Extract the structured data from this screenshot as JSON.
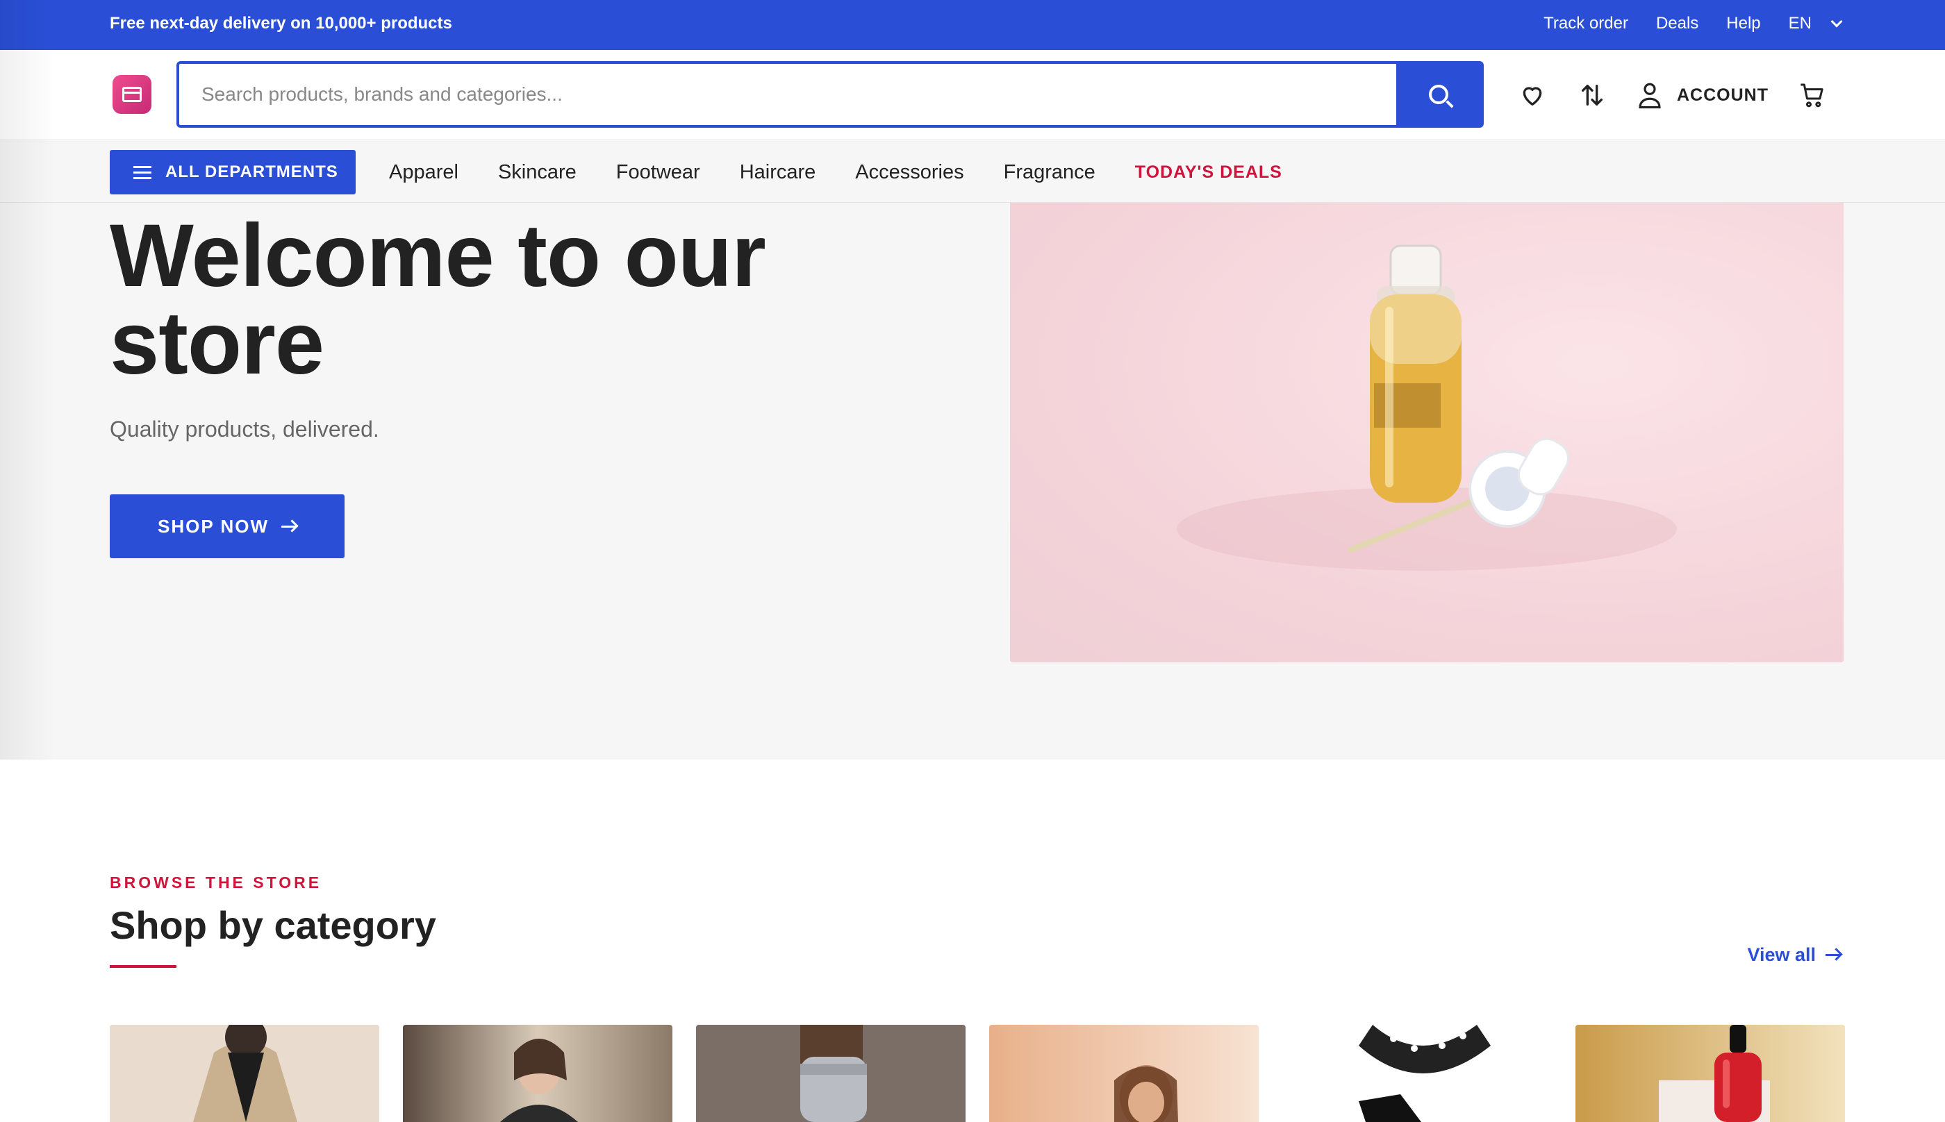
{
  "topbar": {
    "promo": "Free next-day delivery on 10,000+ products",
    "links": [
      "Track order",
      "Deals",
      "Help",
      "EN"
    ]
  },
  "header": {
    "search_placeholder": "Search products, brands and categories...",
    "account_label": "ACCOUNT"
  },
  "nav": {
    "departments_label": "ALL DEPARTMENTS",
    "items": [
      "Apparel",
      "Skincare",
      "Footwear",
      "Haircare",
      "Accessories",
      "Fragrance"
    ],
    "deals_label": "TODAY'S DEALS"
  },
  "hero": {
    "title": "Welcome to our store",
    "subtitle": "Quality products, delivered.",
    "cta": "SHOP NOW"
  },
  "categories": {
    "eyebrow": "BROWSE THE STORE",
    "title": "Shop by category",
    "view_all": "View all"
  },
  "colors": {
    "primary": "#2a4fd6",
    "accent": "#d0143b",
    "logo": "#e23d85"
  },
  "icons": [
    "search-icon",
    "heart-icon",
    "compare-icon",
    "user-icon",
    "cart-icon",
    "chevron-down-icon",
    "menu-icon",
    "arrow-right-icon"
  ]
}
